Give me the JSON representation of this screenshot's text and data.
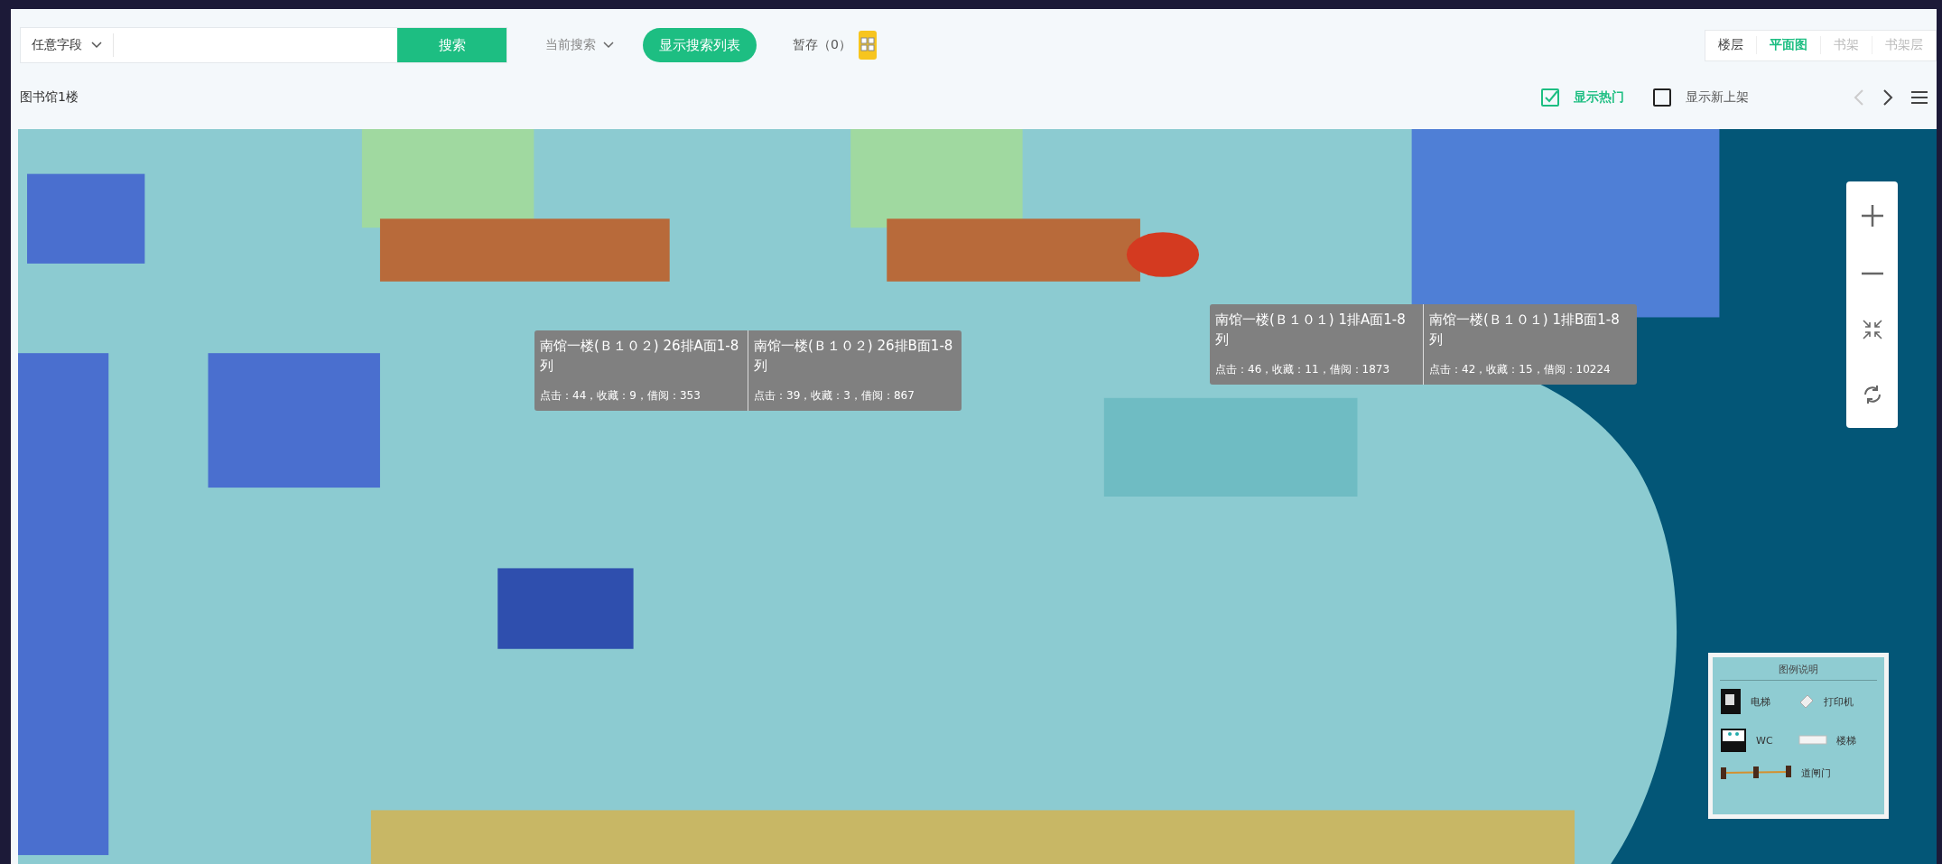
{
  "search": {
    "field_select": "任意字段",
    "button": "搜索",
    "current_search": "当前搜索",
    "show_list_button": "显示搜索列表",
    "saved": "暂存（0）"
  },
  "view_tabs": [
    {
      "label": "楼层",
      "selected": false,
      "disabled": false
    },
    {
      "label": "平面图",
      "selected": true,
      "disabled": false
    },
    {
      "label": "书架",
      "selected": false,
      "disabled": true
    },
    {
      "label": "书架层",
      "selected": false,
      "disabled": true
    }
  ],
  "location": "图书馆1楼",
  "toggles": [
    {
      "label": "显示热门",
      "checked": true
    },
    {
      "label": "显示新上架",
      "checked": false
    }
  ],
  "nav": {
    "prev_disabled": true
  },
  "map": {
    "tooltip_groups": [
      [
        {
          "title": "南馆一楼(Ｂ１０２) 26排A面1-8列",
          "stats": "点击：44，收藏：9，借阅：353"
        },
        {
          "title": "南馆一楼(Ｂ１０２) 26排B面1-8列",
          "stats": "点击：39，收藏：3，借阅：867"
        }
      ],
      [
        {
          "title": "南馆一楼(Ｂ１０１) 1排A面1-8列",
          "stats": "点击：46，收藏：11，借阅：1873"
        },
        {
          "title": "南馆一楼(Ｂ１０１) 1排B面1-8列",
          "stats": "点击：42，收藏：15，借阅：10224"
        }
      ]
    ]
  },
  "legend": {
    "title": "图例说明",
    "items": [
      {
        "kind": "elevator",
        "label": "电梯"
      },
      {
        "kind": "printer",
        "label": "打印机"
      },
      {
        "kind": "wc",
        "label": "WC"
      },
      {
        "kind": "stairs",
        "label": "楼梯"
      },
      {
        "kind": "gate",
        "label": "道闸门"
      }
    ]
  }
}
